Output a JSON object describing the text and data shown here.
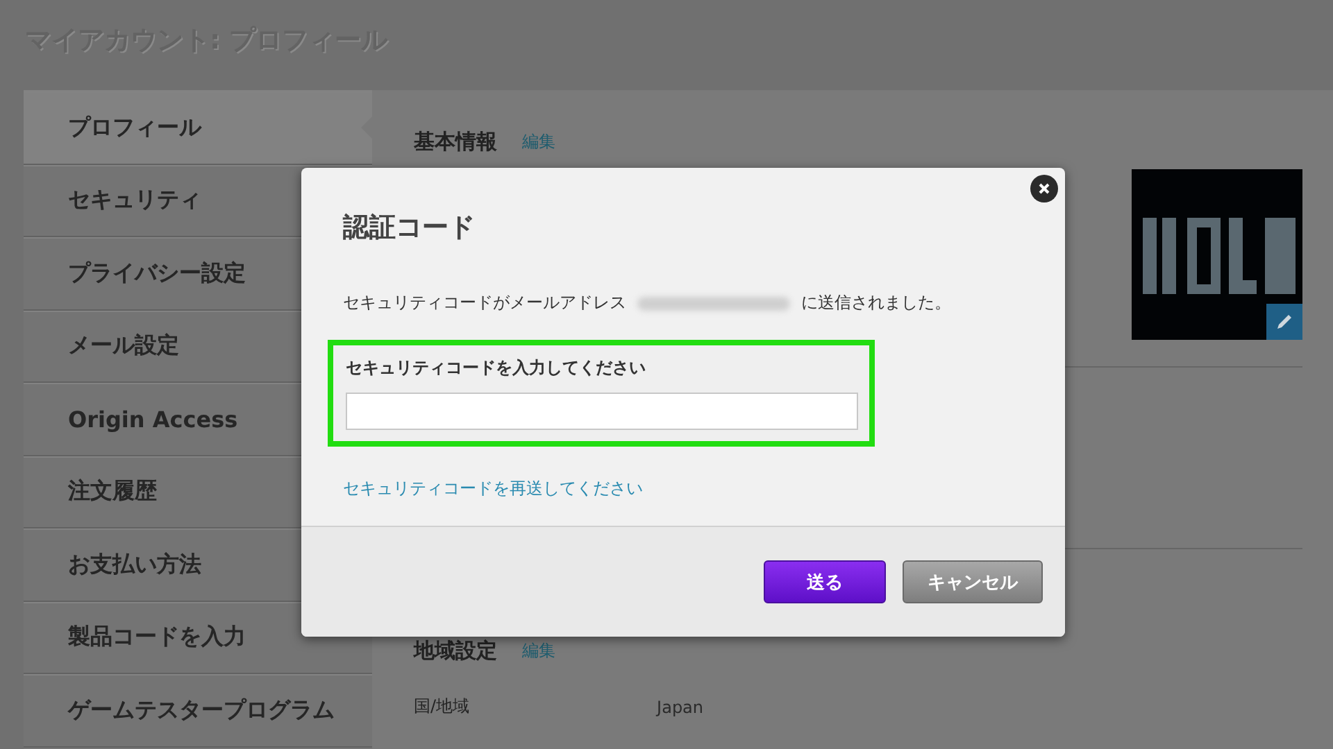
{
  "page_title": "マイアカウント: プロフィール",
  "sidebar": {
    "items": [
      {
        "label": "プロフィール",
        "selected": true
      },
      {
        "label": "セキュリティ",
        "selected": false
      },
      {
        "label": "プライバシー設定",
        "selected": false
      },
      {
        "label": "メール設定",
        "selected": false
      },
      {
        "label": "Origin Access",
        "selected": false
      },
      {
        "label": "注文履歴",
        "selected": false
      },
      {
        "label": "お支払い方法",
        "selected": false
      },
      {
        "label": "製品コードを入力",
        "selected": false
      },
      {
        "label": "ゲームテスタープログラム",
        "selected": false
      }
    ]
  },
  "main": {
    "basic_info": {
      "heading": "基本情報",
      "edit_link": "編集"
    },
    "region": {
      "heading": "地域設定",
      "edit_link": "編集",
      "fields": [
        {
          "label": "国/地域",
          "value": "Japan"
        }
      ]
    }
  },
  "dialog": {
    "title": "認証コード",
    "message_before": "セキュリティコードがメールアドレス",
    "message_after": "に送信されました。",
    "field_label": "セキュリティコードを入力してください",
    "highlighted": true,
    "resend_link": "セキュリティコードを再送してください",
    "buttons": [
      {
        "label": "送る",
        "kind": "primary"
      },
      {
        "label": "キャンセル",
        "kind": "secondary"
      }
    ]
  }
}
